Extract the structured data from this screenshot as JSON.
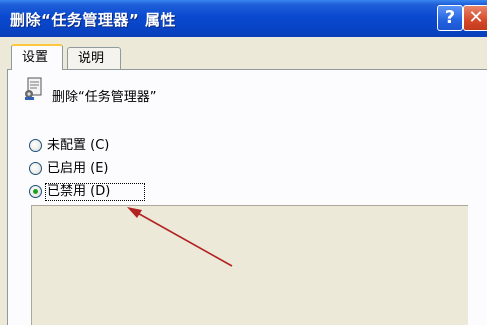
{
  "window": {
    "title": "删除“任务管理器” 属性",
    "help_label": "?",
    "close_label": "✕"
  },
  "tabs": [
    {
      "label": "设置",
      "active": true
    },
    {
      "label": "说明",
      "active": false
    }
  ],
  "policy": {
    "icon": "policy-setting-icon",
    "title": "删除“任务管理器”"
  },
  "options": [
    {
      "label": "未配置 (C)",
      "selected": false
    },
    {
      "label": "已启用 (E)",
      "selected": false
    },
    {
      "label": "已禁用 (D)",
      "selected": true
    }
  ],
  "colors": {
    "titlebar": "#0a49d0",
    "dialog_bg": "#ece9d8",
    "close_button": "#d6482a",
    "annotation_arrow": "#b22222"
  }
}
